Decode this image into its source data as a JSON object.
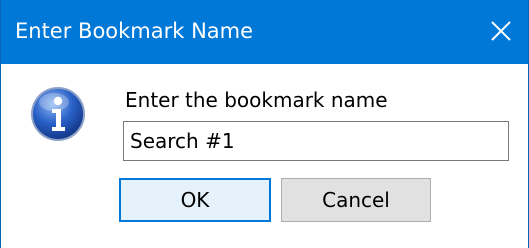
{
  "window": {
    "title": "Enter Bookmark Name",
    "close_icon": "close-icon",
    "titlebar_color": "#0078d7"
  },
  "dialog": {
    "icon": "info-icon",
    "prompt": "Enter the bookmark name",
    "input_value": "Search #1",
    "ok_label": "OK",
    "cancel_label": "Cancel"
  }
}
